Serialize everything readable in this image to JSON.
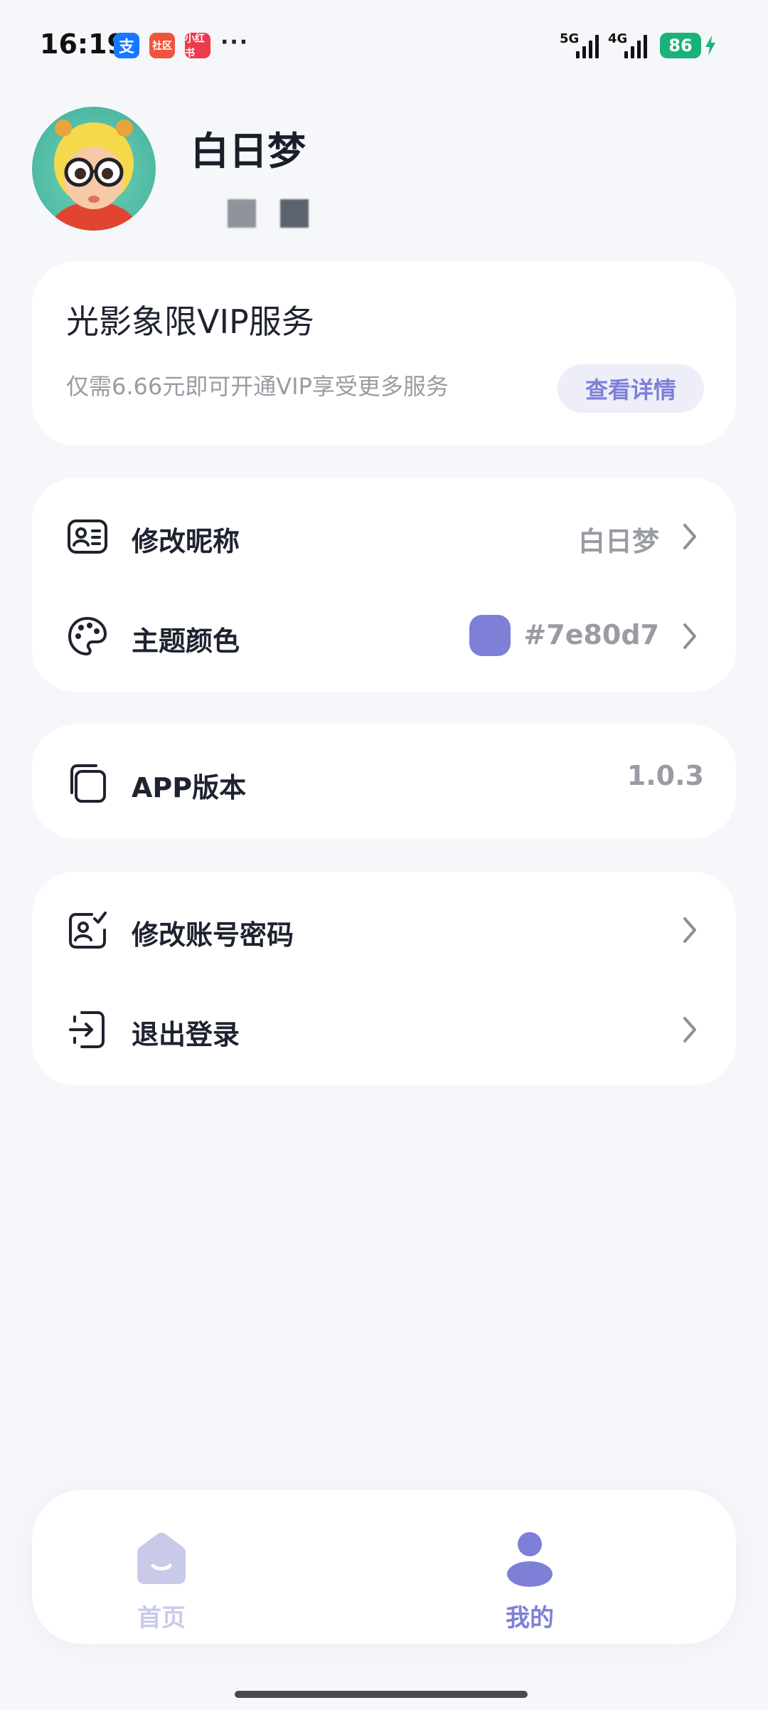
{
  "status_bar": {
    "time": "16:19",
    "notifications": [
      {
        "icon": "alipay-icon",
        "text": "支"
      },
      {
        "icon": "community-app-icon",
        "text": "社区"
      },
      {
        "icon": "xiaohongshu-icon",
        "text": "小红书"
      }
    ],
    "more": "···",
    "network_1": "5G",
    "network_2": "4G",
    "battery": "86"
  },
  "profile": {
    "avatar": "cartoon-avatar",
    "username": "白日梦"
  },
  "vip_card": {
    "title": "光影象限VIP服务",
    "description": "仅需6.66元即可开通VIP享受更多服务",
    "button_label": "查看详情"
  },
  "settings": {
    "nickname": {
      "icon": "id-card-icon",
      "label": "修改昵称",
      "value": "白日梦"
    },
    "theme": {
      "icon": "palette-icon",
      "label": "主题颜色",
      "value": "#7e80d7",
      "swatch_color": "#7e80d7"
    }
  },
  "version": {
    "icon": "layers-icon",
    "label": "APP版本",
    "value": "1.0.3"
  },
  "account": {
    "password": {
      "icon": "user-edit-icon",
      "label": "修改账号密码"
    },
    "logout": {
      "icon": "logout-icon",
      "label": "退出登录"
    }
  },
  "bottom_nav": {
    "items": [
      {
        "icon": "home-icon",
        "label": "首页",
        "active": false
      },
      {
        "icon": "user-icon",
        "label": "我的",
        "active": true
      }
    ]
  },
  "colors": {
    "accent": "#7e80d7",
    "accent_light": "#c9cae9",
    "background": "#f6f7fa",
    "card": "#ffffff",
    "text_primary": "#1f2330",
    "text_secondary": "#9a9ca3"
  }
}
